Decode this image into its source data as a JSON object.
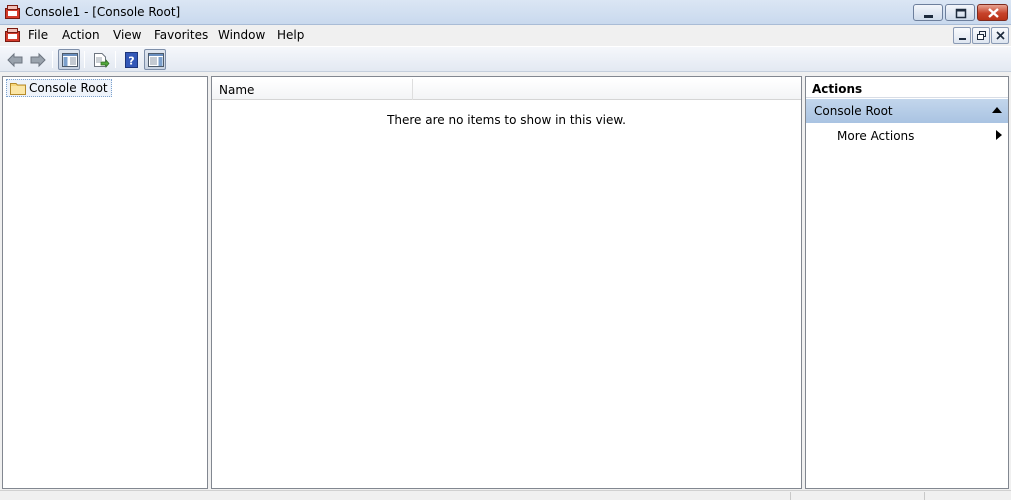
{
  "window": {
    "title": "Console1 - [Console Root]"
  },
  "menu": {
    "items": [
      "File",
      "Action",
      "View",
      "Favorites",
      "Window",
      "Help"
    ]
  },
  "toolbar": {
    "buttons": [
      "back-icon",
      "forward-icon",
      "show-hide-tree-icon",
      "export-list-icon",
      "help-icon",
      "show-hide-action-pane-icon"
    ]
  },
  "tree": {
    "root_label": "Console Root"
  },
  "list": {
    "columns": [
      "Name"
    ],
    "empty_message": "There are no items to show in this view."
  },
  "actions": {
    "title": "Actions",
    "group_label": "Console Root",
    "items": [
      "More Actions"
    ]
  },
  "colors": {
    "selection_header": "#b7cde8",
    "close_button": "#c7432b"
  }
}
